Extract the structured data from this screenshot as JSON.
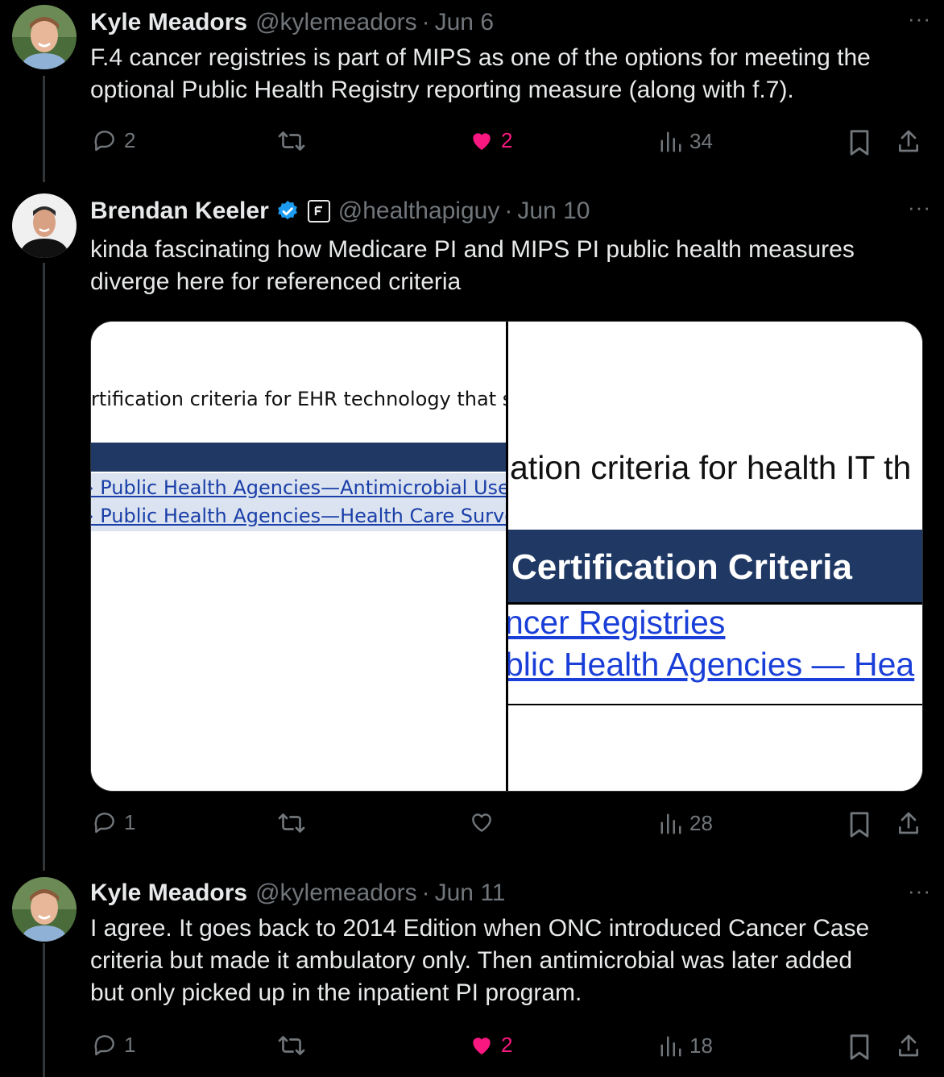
{
  "tweets": [
    {
      "name": "Kyle Meadors",
      "handle": "@kylemeadors",
      "sep": "·",
      "date": "Jun 6",
      "more": "···",
      "text_lines": [
        "F.4 cancer registries is part of MIPS as one of the options for meeting the",
        "optional Public Health Registry reporting measure (along with f.7)."
      ],
      "replies": "2",
      "likes": "2",
      "views": "34"
    },
    {
      "name": "Brendan Keeler",
      "handle": "@healthapiguy",
      "sep": "·",
      "date": "Jun 10",
      "more": "···",
      "text_lines": [
        "kinda fascinating how Medicare PI and MIPS PI public health measures",
        "diverge here for referenced criteria"
      ],
      "replies": "1",
      "likes": "",
      "views": "28",
      "media": {
        "left_panel": {
          "heading": "rtification criteria for EHR technology that su",
          "link1": "› Public Health Agencies—Antimicrobial Use",
          "link2": "› Public Health Agencies—Health Care Surve"
        },
        "right_panel": {
          "heading": "ation criteria for health IT th",
          "bar_title": "Certification Criteria",
          "link1": "ncer Registries",
          "link2": "blic Health Agencies — Hea"
        }
      }
    },
    {
      "name": "Kyle Meadors",
      "handle": "@kylemeadors",
      "sep": "·",
      "date": "Jun 11",
      "more": "···",
      "text_lines": [
        "I agree. It goes back to 2014 Edition when ONC introduced Cancer Case",
        "criteria but made it ambulatory only. Then antimicrobial was later added",
        "but only picked up in the inpatient PI program."
      ],
      "replies": "1",
      "likes": "2",
      "views": "18"
    }
  ],
  "colors": {
    "accent_like": "#f91880",
    "muted": "#71767b",
    "verified": "#1d9bf0",
    "link": "#1a0dab",
    "table_header": "#1f3864"
  }
}
